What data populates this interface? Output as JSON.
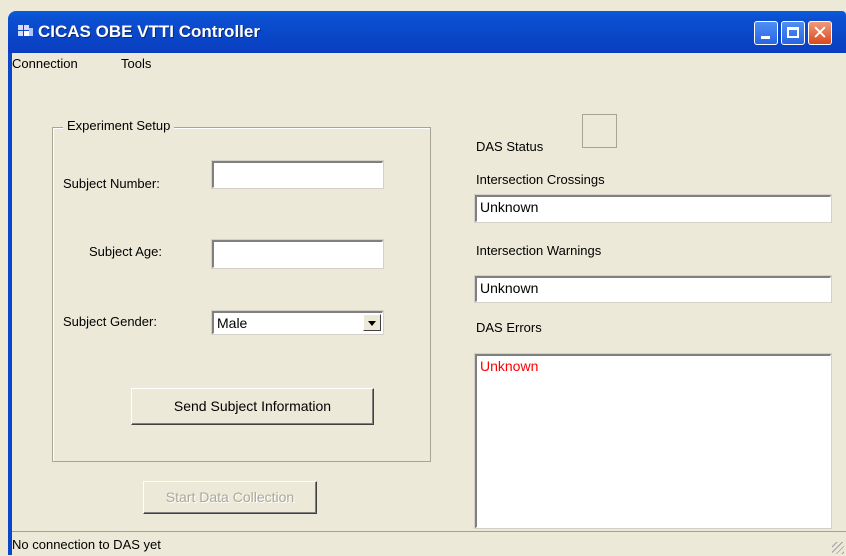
{
  "window": {
    "title": "CICAS OBE VTTI Controller"
  },
  "menu": {
    "items": [
      "Connection",
      "Tools"
    ]
  },
  "experiment_setup": {
    "legend": "Experiment Setup",
    "subject_number_label": "Subject Number:",
    "subject_number_value": "",
    "subject_age_label": "Subject Age:",
    "subject_age_value": "",
    "subject_gender_label": "Subject Gender:",
    "subject_gender_value": "Male",
    "send_button": "Send Subject Information"
  },
  "start_button": "Start Data Collection",
  "das": {
    "status_label": "DAS Status",
    "crossings_label": "Intersection Crossings",
    "crossings_value": "Unknown",
    "warnings_label": "Intersection Warnings",
    "warnings_value": "Unknown",
    "errors_label": "DAS Errors",
    "errors_value": "Unknown",
    "errors_color": "#ff0000"
  },
  "statusbar": {
    "text": "No connection to DAS yet"
  },
  "icons": [
    "app-icon",
    "minimize-icon",
    "maximize-icon",
    "close-icon",
    "dropdown-arrow-icon",
    "resize-grip-icon"
  ]
}
